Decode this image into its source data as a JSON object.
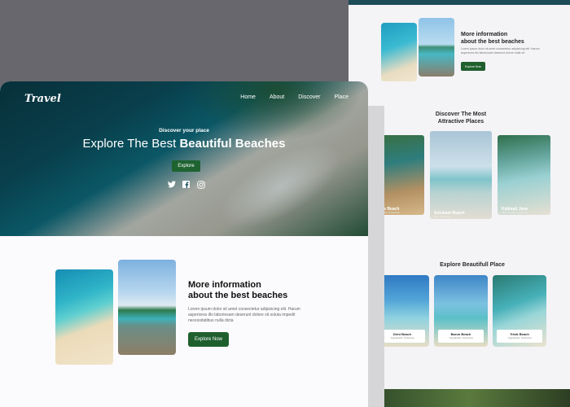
{
  "back_page": {
    "info": {
      "title_line1": "More information",
      "title_line2": "about the best beaches",
      "text": "Lorem ipsum dolor sit amet consectetur adipisicing elit. Harum asperiores illo laboriosam deserunt dolore nulla sit.",
      "button": "Explore Now"
    },
    "discover": {
      "title_line1": "Discover The Most",
      "title_line2": "Attractive Places",
      "cards": [
        {
          "name": "Pakis Beach",
          "location": "Yogyakarta, Indonesia"
        },
        {
          "name": "Sulubam Beach",
          "location": "Bali, Indonesia"
        },
        {
          "name": "Kalimati Java",
          "location": "Jawa Tengah, Indonesia"
        }
      ]
    },
    "places": {
      "title": "Explore Beautifull Place",
      "cards": [
        {
          "name": "Drini Beach",
          "location": "Yogyakarta, Indonesia"
        },
        {
          "name": "Baron Beach",
          "location": "Yogyakarta, Indonesia"
        },
        {
          "name": "Trisik Beach",
          "location": "Yogyakarta, Indonesia"
        }
      ]
    }
  },
  "hero": {
    "logo": "Travel",
    "nav": [
      "Home",
      "About",
      "Discover",
      "Place"
    ],
    "subtitle": "Discover your place",
    "title_plain": "Explore The Best ",
    "title_bold": "Beautiful Beaches",
    "button": "Explore",
    "socials": [
      "twitter-icon",
      "facebook-icon",
      "instagram-icon"
    ]
  },
  "info": {
    "title_line1": "More information",
    "title_line2": "about the best beaches",
    "text": "Lorem ipsum dolor sit amet consectetur adipisicing elit. Harum asperiores illo laboriosam deserunt dolore sit soluta impedit necessitatibus nulla dicta",
    "button": "Explore Now"
  },
  "colors": {
    "accent_green": "#1f5f2e",
    "backdrop": "#68676d"
  }
}
